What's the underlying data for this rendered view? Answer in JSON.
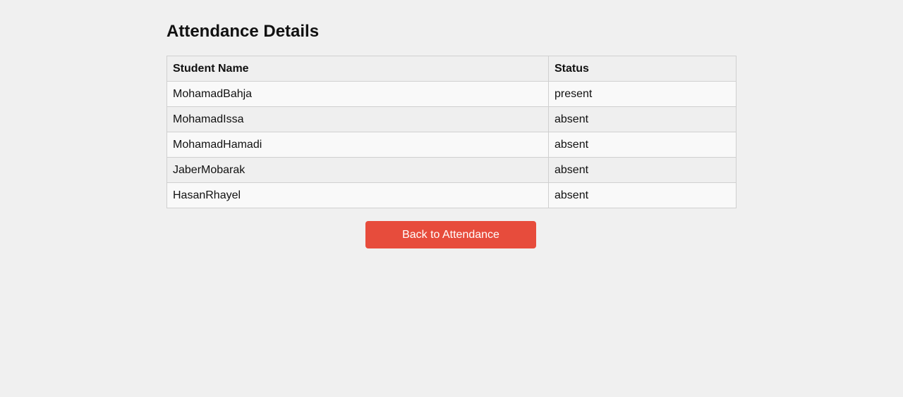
{
  "page": {
    "title": "Attendance Details"
  },
  "table": {
    "headers": {
      "name": "Student Name",
      "status": "Status"
    },
    "rows": [
      {
        "name": "MohamadBahja",
        "status": "present"
      },
      {
        "name": "MohamadIssa",
        "status": "absent"
      },
      {
        "name": "MohamadHamadi",
        "status": "absent"
      },
      {
        "name": "JaberMobarak",
        "status": "absent"
      },
      {
        "name": "HasanRhayel",
        "status": "absent"
      }
    ]
  },
  "actions": {
    "back_label": "Back to Attendance"
  },
  "colors": {
    "background": "#f0f0f0",
    "button": "#e74c3c",
    "button_text": "#ffffff"
  }
}
